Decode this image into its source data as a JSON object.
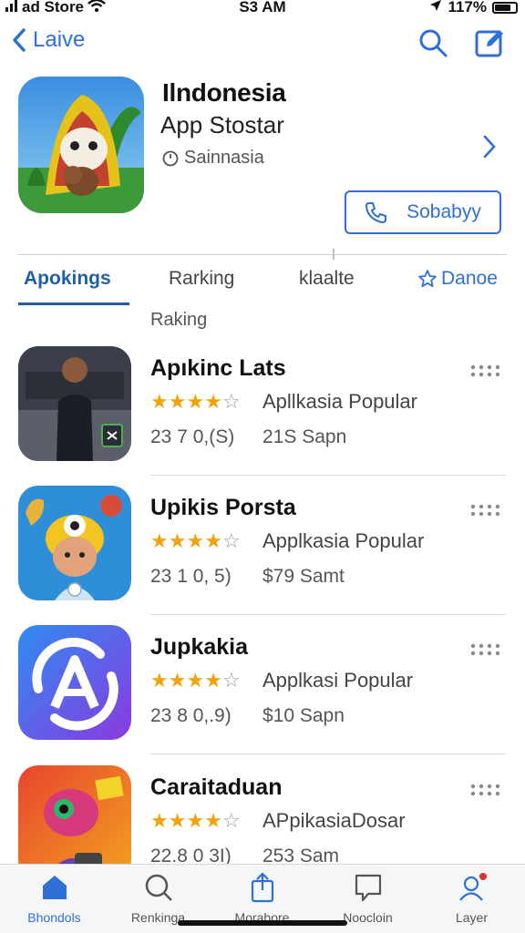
{
  "status_bar": {
    "carrier": "ad Store",
    "time": "S3 AM",
    "battery_text": "117%"
  },
  "nav": {
    "back_label": "Laive",
    "search_icon": "search-icon",
    "compose_icon": "compose-icon"
  },
  "app": {
    "title": "Ilndonesia",
    "subtitle": "App Stostar",
    "region": "Sainnasia",
    "subscribe_label": "Sobabyy"
  },
  "tabs": [
    {
      "label": "Apokings",
      "active": true
    },
    {
      "label": "Rarking",
      "active": false
    },
    {
      "label": "klaalte",
      "active": false
    },
    {
      "label": "Danoe",
      "active": false
    }
  ],
  "section_label": "Raking",
  "list": [
    {
      "title": "Apıkinc Lats",
      "rating": 4,
      "category": "Apllkasia Popular",
      "count": "23 7 0,(S)",
      "size": "21S Sapn",
      "icon": "person-icon"
    },
    {
      "title": "Upikis Porsta",
      "rating": 4,
      "category": "Applkasia Popular",
      "count": "23 1 0, 5)",
      "size": "$79 Samt",
      "icon": "character-icon"
    },
    {
      "title": "Jupkakia",
      "rating": 4,
      "category": "Applkasi Popular",
      "count": "23 8 0,.9)",
      "size": "$10 Sapn",
      "icon": "a-logo-icon"
    },
    {
      "title": "Caraitaduan",
      "rating": 4,
      "category": "APpikasiaDosar",
      "count": "22.8 0 3I)",
      "size": "253 Sam",
      "icon": "robot-icon"
    }
  ],
  "tab_bar": [
    {
      "label": "Bhondols",
      "icon": "home-icon",
      "active": true
    },
    {
      "label": "Renkinga",
      "icon": "search-icon",
      "active": false
    },
    {
      "label": "Morabore",
      "icon": "share-icon",
      "active": false
    },
    {
      "label": "Noocloin",
      "icon": "message-icon",
      "active": false
    },
    {
      "label": "Layer",
      "icon": "user-icon",
      "active": false
    }
  ],
  "colors": {
    "accent": "#2f6fd6",
    "tab_active": "#1f5fa8",
    "star": "#f2a20c"
  }
}
